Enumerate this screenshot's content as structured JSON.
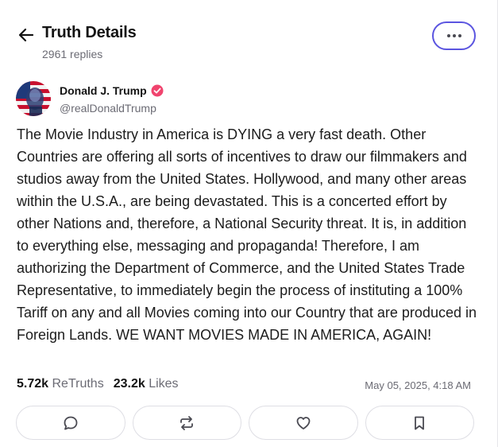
{
  "header": {
    "title": "Truth Details",
    "replies": "2961 replies"
  },
  "post": {
    "author_name": "Donald J. Trump",
    "handle": "@realDonaldTrump",
    "text": "The Movie Industry in America is DYING a very fast death. Other Countries are offering all sorts of incentives to draw our filmmakers and studios away from the United States. Hollywood, and many other areas within the U.S.A., are being devastated. This is a concerted effort by other Nations and, therefore, a National Security threat. It is, in addition to everything else, messaging and propaganda! Therefore, I am authorizing the Department of Commerce, and the United States Trade Representative, to immediately begin the process of instituting a 100% Tariff on any and all Movies coming into our Country that are produced in Foreign Lands. WE WANT MOVIES MADE IN AMERICA, AGAIN!",
    "retruths_count": "5.72k",
    "retruths_label": "ReTruths",
    "likes_count": "23.2k",
    "likes_label": "Likes",
    "timestamp": "May 05, 2025, 4:18 AM"
  },
  "icons": {
    "back": "arrow-left-icon",
    "more": "more-horizontal-icon",
    "verified": "verified-badge-icon",
    "reply": "reply-bubble-icon",
    "retruth": "repost-arrows-icon",
    "like": "heart-icon",
    "bookmark": "bookmark-icon"
  },
  "colors": {
    "accent": "#5b55e0",
    "verified": "#f0446e",
    "muted_text": "#6b6b74"
  }
}
